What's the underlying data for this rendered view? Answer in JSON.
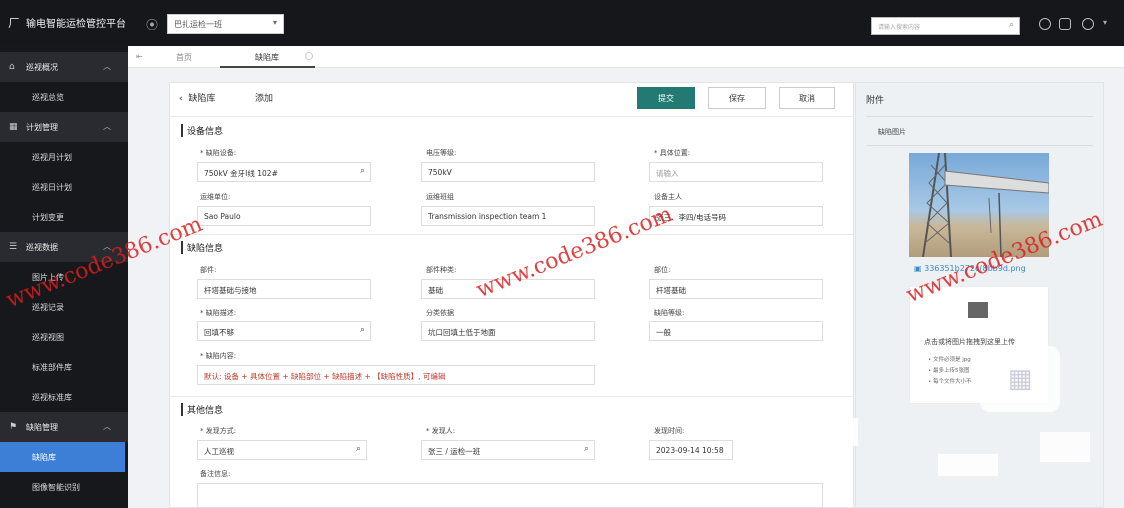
{
  "header": {
    "app_title": "输电智能运检管控平台",
    "team_select": "巴扎运检一班",
    "search_placeholder": "请输入搜索内容"
  },
  "sidebar": {
    "groups": [
      {
        "label": "巡视概况",
        "items": [
          "巡视总览"
        ]
      },
      {
        "label": "计划管理",
        "items": [
          "巡视月计划",
          "巡视日计划",
          "计划变更"
        ]
      },
      {
        "label": "巡视数据",
        "items": [
          "图片上传",
          "巡视记录",
          "巡视视图",
          "标准部件库",
          "巡视标准库"
        ]
      },
      {
        "label": "缺陷管理",
        "items": [
          "缺陷库",
          "图像智能识别"
        ]
      }
    ],
    "active_item": "缺陷库"
  },
  "tabs": {
    "home": "首页",
    "current": "缺陷库"
  },
  "form": {
    "breadcrumb_parent": "缺陷库",
    "breadcrumb_current": "添加",
    "buttons": {
      "submit": "提交",
      "save": "保存",
      "cancel": "取消"
    },
    "sections": {
      "device": "设备信息",
      "defect": "缺陷信息",
      "other": "其他信息"
    },
    "fields": {
      "defect_device": {
        "label": "* 缺陷设备:",
        "value": "750kV 金牙Ⅰ线 102#"
      },
      "voltage": {
        "label": "电压等级:",
        "value": "750kV"
      },
      "location": {
        "label": "* 具体位置:",
        "placeholder": "请输入"
      },
      "ops_unit": {
        "label": "运维单位:",
        "value": "Sao Paulo"
      },
      "ops_team": {
        "label": "运维班组",
        "value": "Transmission inspection team 1"
      },
      "device_owner": {
        "label": "设备主人",
        "value": "张三、李四/电话号码"
      },
      "part": {
        "label": "部件:",
        "value": "杆塔基础与接地"
      },
      "part_type": {
        "label": "部件种类:",
        "value": "基础"
      },
      "position": {
        "label": "部位:",
        "value": "杆塔基础"
      },
      "defect_desc": {
        "label": "* 缺陷描述:",
        "value": "回填不够"
      },
      "basis": {
        "label": "分类依据",
        "value": "坑口回填土低于地面"
      },
      "level": {
        "label": "缺陷等级:",
        "value": "一般"
      },
      "content": {
        "label": "* 缺陷内容:",
        "value": "默认: 设备 + 具体位置 + 缺陷部位 + 缺陷描述 + 【缺陷性质】, 可编辑"
      },
      "found_method": {
        "label": "* 发现方式:",
        "value": "人工巡视"
      },
      "finder": {
        "label": "* 发现人:",
        "value": "张三 / 运检一班"
      },
      "found_time": {
        "label": "发现时间:",
        "value": "2023-09-14 10:58"
      },
      "remarks": {
        "label": "备注信息:"
      }
    }
  },
  "attachments": {
    "title": "附件",
    "subtitle": "缺陷图片",
    "file_name": "336351b272c(8bb9d.png",
    "upload_hint": "点击或将图片拖拽到这里上传",
    "upload_rules": [
      "• 文件必须是 jpg",
      "• 最多上传5张图",
      "• 每个文件大小不"
    ]
  },
  "watermark": "www.code386.com",
  "colors": {
    "primary": "#237a72",
    "sidebar_active": "#3d7fd6",
    "required": "#c0392b"
  }
}
